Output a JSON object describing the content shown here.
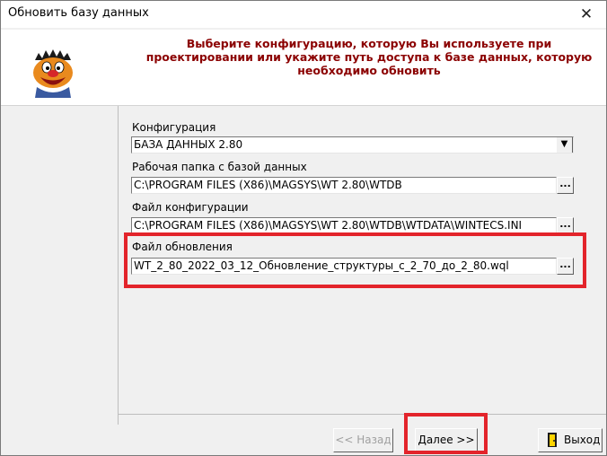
{
  "window": {
    "title": "Обновить базу данных",
    "close_glyph": "✕"
  },
  "header": {
    "instruction": "Выберите конфигурацию, которую Вы используете при проектировании или укажите путь доступа к базе данных, которую необходимо обновить"
  },
  "fields": {
    "config_label": "Конфигурация",
    "config_value": "БАЗА ДАННЫХ 2.80",
    "workdir_label": "Рабочая папка с базой данных",
    "workdir_value": "C:\\PROGRAM FILES (X86)\\MAGSYS\\WT 2.80\\WTDB",
    "configfile_label": "Файл конфигурации",
    "configfile_value": "C:\\PROGRAM FILES (X86)\\MAGSYS\\WT 2.80\\WTDB\\WTDATA\\WINTECS.INI",
    "update_label": "Файл обновления",
    "update_value": "WT_2_80_2022_03_12_Обновление_структуры_с_2_70_до_2_80.wql",
    "browse_glyph": "...",
    "dropdown_glyph": "▼"
  },
  "buttons": {
    "back": "<< Назад",
    "next": "Далее >>",
    "exit": "Выход"
  },
  "colors": {
    "header_text": "#8b0000",
    "highlight": "#e3242b",
    "exit_icon": "#1a1a1a"
  },
  "icons": {
    "mascot": "cartoon-face-icon",
    "exit": "exit-door-icon"
  }
}
